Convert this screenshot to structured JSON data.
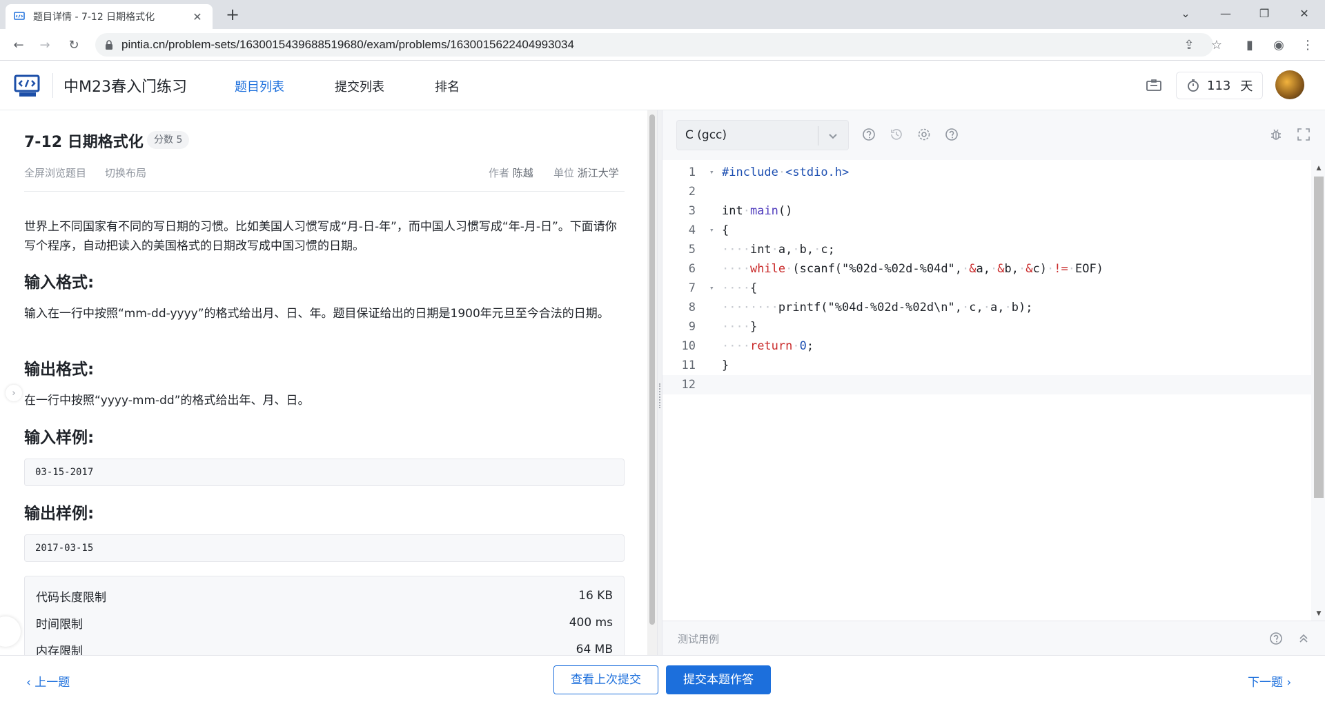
{
  "browser": {
    "tab_title": "题目详情 - 7-12 日期格式化",
    "url": "pintia.cn/problem-sets/1630015439688519680/exam/problems/1630015622404993034"
  },
  "header": {
    "course_title": "中M23春入门练习",
    "nav": [
      {
        "label": "题目列表",
        "active": true
      },
      {
        "label": "提交列表",
        "active": false
      },
      {
        "label": "排名",
        "active": false
      }
    ],
    "timer_value": "113",
    "timer_unit": "天"
  },
  "problem": {
    "title": "7-12 日期格式化",
    "score": "分数 5",
    "tools": [
      "全屏浏览题目",
      "切换布局"
    ],
    "author_label": "作者",
    "author": "陈越",
    "org_label": "单位",
    "org": "浙江大学",
    "description": "世界上不同国家有不同的写日期的习惯。比如美国人习惯写成“月-日-年”，而中国人习惯写成“年-月-日”。下面请你写个程序，自动把读入的美国格式的日期改写成中国习惯的日期。",
    "input_heading": "输入格式:",
    "input_text": "输入在一行中按照“mm-dd-yyyy”的格式给出月、日、年。题目保证给出的日期是1900年元旦至今合法的日期。",
    "output_heading": "输出格式:",
    "output_text": "在一行中按照“yyyy-mm-dd”的格式给出年、月、日。",
    "sample_in_heading": "输入样例:",
    "sample_in": "03-15-2017",
    "sample_out_heading": "输出样例:",
    "sample_out": "2017-03-15",
    "limits": [
      {
        "label": "代码长度限制",
        "value": "16 KB"
      },
      {
        "label": "时间限制",
        "value": "400 ms"
      },
      {
        "label": "内存限制",
        "value": "64 MB"
      }
    ]
  },
  "editor": {
    "language": "C (gcc)",
    "lines": [
      {
        "n": "1",
        "fold": "▾",
        "html": "<span class=\"tk-pre\">#include</span><span class=\"tk-dot\">·</span><span class=\"tk-pre\">&lt;stdio.h&gt;</span>"
      },
      {
        "n": "2",
        "fold": "",
        "html": ""
      },
      {
        "n": "3",
        "fold": "",
        "html": "int<span class=\"tk-dot\">·</span><span class=\"tk-fn\">main</span>()"
      },
      {
        "n": "4",
        "fold": "▾",
        "html": "{"
      },
      {
        "n": "5",
        "fold": "",
        "html": "<span class=\"tk-dot\">····</span>int<span class=\"tk-dot\">·</span>a,<span class=\"tk-dot\">·</span>b,<span class=\"tk-dot\">·</span>c;"
      },
      {
        "n": "6",
        "fold": "",
        "html": "<span class=\"tk-dot\">····</span><span class=\"tk-kw\">while</span><span class=\"tk-dot\">·</span>(scanf(\"%02d-%02d-%04d\",<span class=\"tk-dot\">·</span><span class=\"tk-kw\">&amp;</span>a,<span class=\"tk-dot\">·</span><span class=\"tk-kw\">&amp;</span>b,<span class=\"tk-dot\">·</span><span class=\"tk-kw\">&amp;</span>c)<span class=\"tk-dot\">·</span><span class=\"tk-kw\">!=</span><span class=\"tk-dot\">·</span>EOF)"
      },
      {
        "n": "7",
        "fold": "▾",
        "html": "<span class=\"tk-dot\">····</span>{"
      },
      {
        "n": "8",
        "fold": "",
        "html": "<span class=\"tk-dot\">········</span>printf(\"%04d-%02d-%02d\\n\",<span class=\"tk-dot\">·</span>c,<span class=\"tk-dot\">·</span>a,<span class=\"tk-dot\">·</span>b);"
      },
      {
        "n": "9",
        "fold": "",
        "html": "<span class=\"tk-dot\">····</span>}"
      },
      {
        "n": "10",
        "fold": "",
        "html": "<span class=\"tk-dot\">····</span><span class=\"tk-kw\">return</span><span class=\"tk-dot\">·</span><span class=\"tk-num\">0</span>;"
      },
      {
        "n": "11",
        "fold": "",
        "html": "}"
      },
      {
        "n": "12",
        "fold": "",
        "html": "",
        "current": true
      }
    ],
    "test_label": "测试用例"
  },
  "footer": {
    "prev": "上一题",
    "view_last": "查看上次提交",
    "submit": "提交本题作答",
    "next": "下一题"
  },
  "colors": {
    "accent": "#1c6fdc",
    "keyword": "#c92a2a",
    "function": "#4f3bbd"
  }
}
